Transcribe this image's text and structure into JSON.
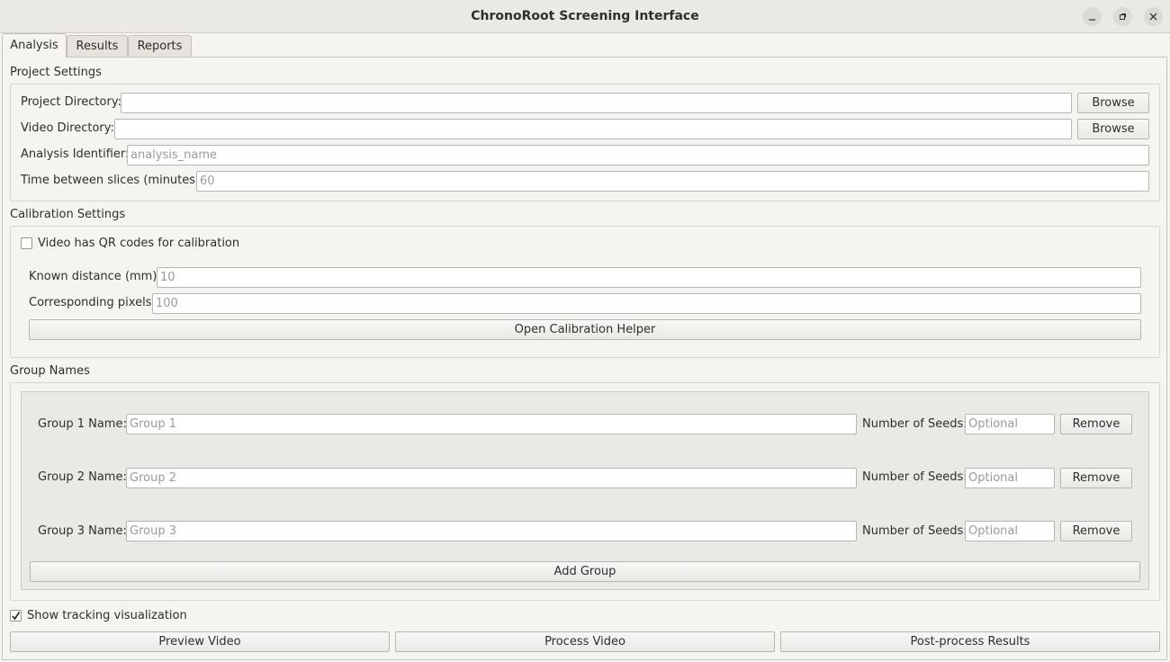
{
  "window": {
    "title": "ChronoRoot Screening Interface"
  },
  "tabs": [
    {
      "label": "Analysis",
      "active": true
    },
    {
      "label": "Results",
      "active": false
    },
    {
      "label": "Reports",
      "active": false
    }
  ],
  "project_settings": {
    "heading": "Project Settings",
    "project_directory_label": "Project Directory:",
    "project_directory_value": "",
    "video_directory_label": "Video Directory:",
    "video_directory_value": "",
    "browse_label": "Browse",
    "analysis_identifier_label": "Analysis Identifier:",
    "analysis_identifier_placeholder": "analysis_name",
    "time_between_label": "Time between slices (minutes):",
    "time_between_placeholder": "60"
  },
  "calibration": {
    "heading": "Calibration Settings",
    "qr_checkbox_label": "Video has QR codes for calibration",
    "qr_checked": false,
    "known_distance_label": "Known distance (mm):",
    "known_distance_placeholder": "10",
    "corresponding_pixels_label": "Corresponding pixels:",
    "corresponding_pixels_placeholder": "100",
    "helper_button": "Open Calibration Helper"
  },
  "groups": {
    "heading": "Group Names",
    "seeds_label": "Number of Seeds:",
    "seeds_placeholder": "Optional",
    "remove_label": "Remove",
    "add_label": "Add Group",
    "items": [
      {
        "label": "Group 1 Name:",
        "placeholder": "Group 1"
      },
      {
        "label": "Group 2 Name:",
        "placeholder": "Group 2"
      },
      {
        "label": "Group 3 Name:",
        "placeholder": "Group 3"
      }
    ]
  },
  "footer": {
    "tracking_label": "Show tracking visualization",
    "tracking_checked": true,
    "preview_button": "Preview Video",
    "process_button": "Process Video",
    "postprocess_button": "Post-process Results"
  },
  "colors": {
    "window_bg": "#f6f4f1",
    "titlebar_bg": "#ebe9e6",
    "group_panel_bg": "#ebe9e6"
  }
}
